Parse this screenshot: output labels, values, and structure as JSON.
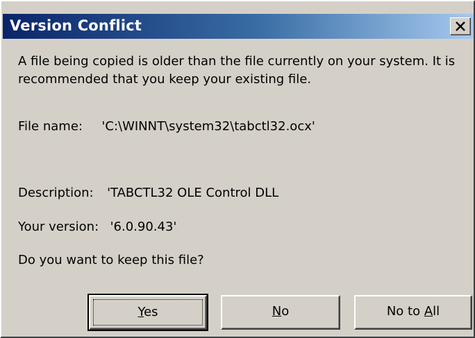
{
  "dialog": {
    "title": "Version Conflict",
    "message": "A file being copied is older than the file currently on your system.  It is recommended that you keep your existing file.",
    "file_name_label": "File name:",
    "file_name_value": "'C:\\WINNT\\system32\\tabctl32.ocx'",
    "description_label": "Description:",
    "description_value": "'TABCTL32 OLE Control DLL",
    "version_label": "Your version:",
    "version_value": "'6.0.90.43'",
    "question": "Do you want to keep this file?"
  },
  "buttons": {
    "yes": {
      "mnemonic": "Y",
      "rest": "es"
    },
    "no": {
      "mnemonic": "N",
      "rest": "o"
    },
    "no_to_all": {
      "pre": "No to ",
      "mnemonic": "A",
      "rest": "ll"
    }
  },
  "colors": {
    "title_start": "#0a246a",
    "title_end": "#a6caf0",
    "face": "#d4d0c8"
  },
  "icons": {
    "close": "close-icon"
  }
}
